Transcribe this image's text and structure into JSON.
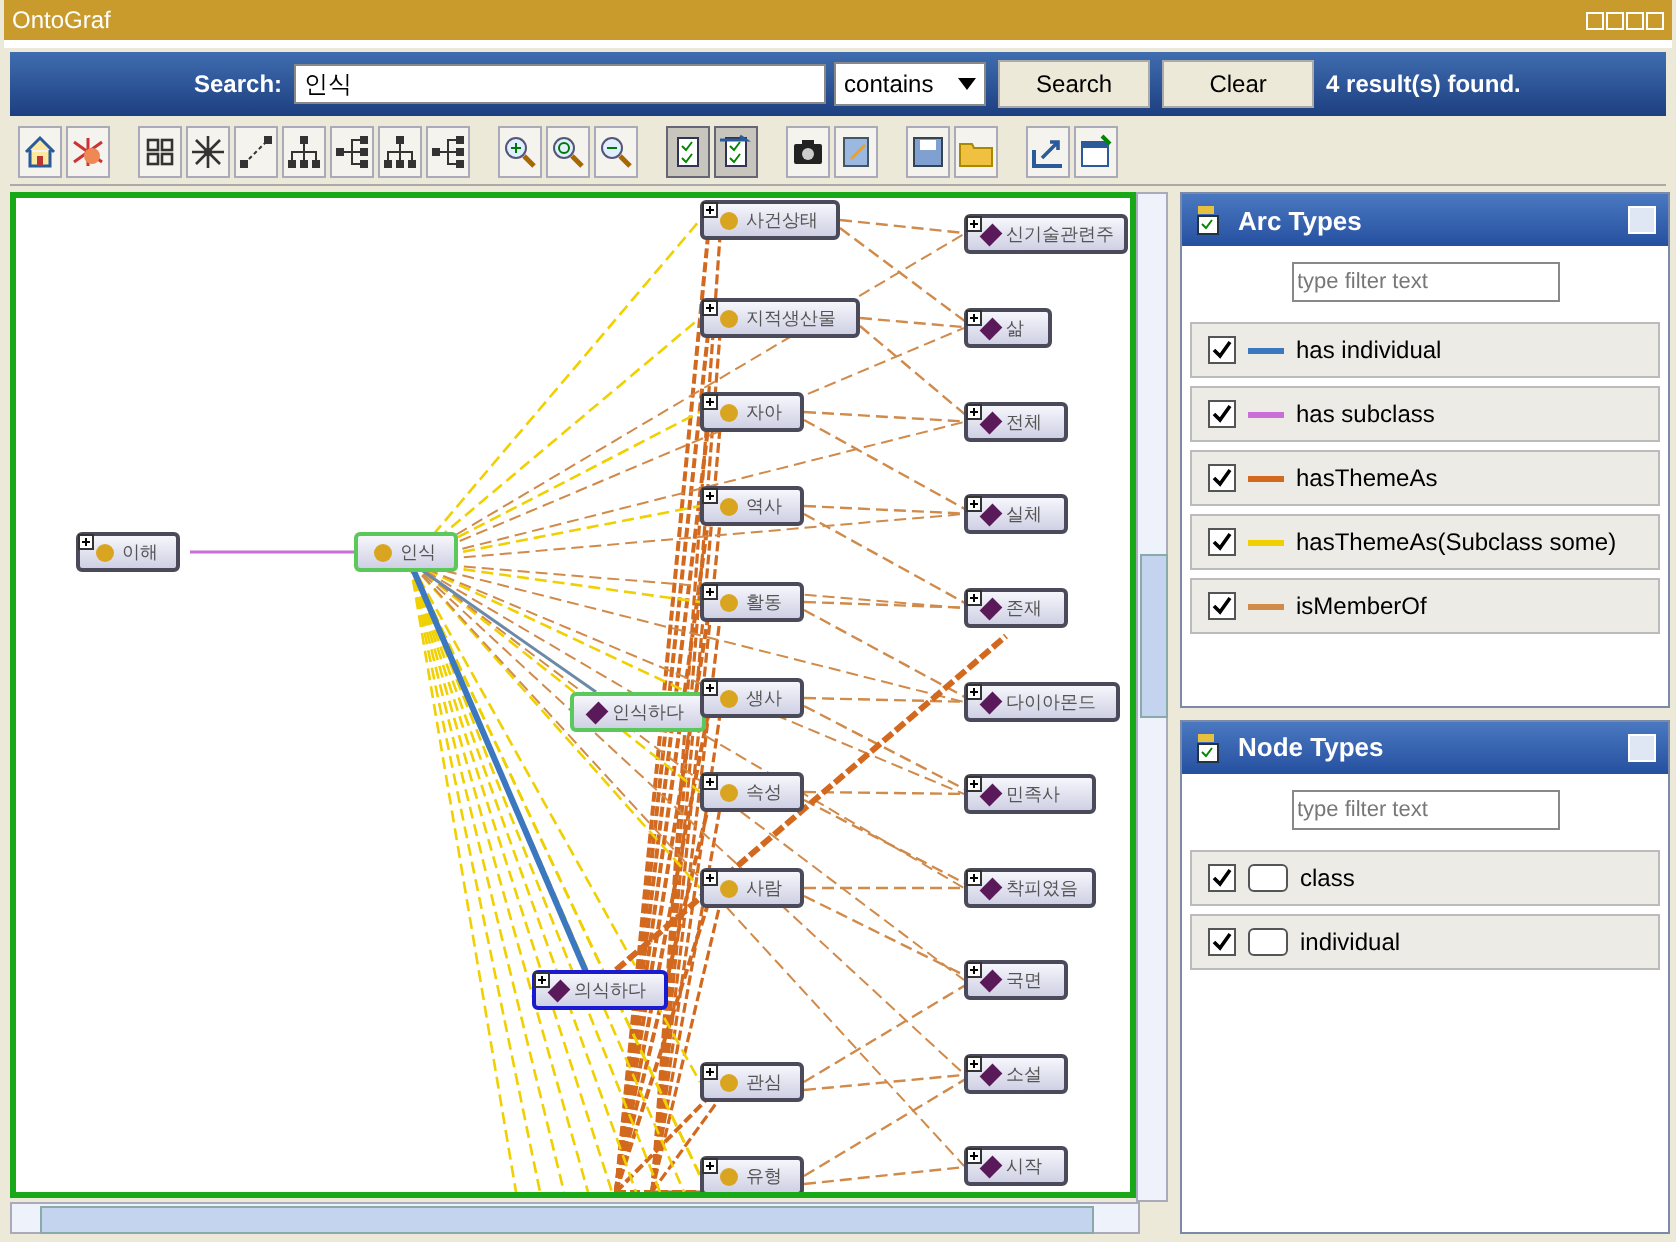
{
  "window": {
    "title": "OntoGraf"
  },
  "search": {
    "label": "Search:",
    "value": "인식",
    "mode": "contains",
    "buttons": [
      "Search",
      "Clear"
    ],
    "result": "4 result(s) found."
  },
  "toolbar": [
    {
      "kind": "home",
      "on": false
    },
    {
      "kind": "network",
      "on": false
    },
    {
      "kind": "grid",
      "on": false
    },
    {
      "kind": "radial",
      "on": false
    },
    {
      "kind": "spring",
      "on": false
    },
    {
      "kind": "tree-down",
      "on": false
    },
    {
      "kind": "tree-right",
      "on": false
    },
    {
      "kind": "tree-down",
      "on": false
    },
    {
      "kind": "tree-right",
      "on": false
    },
    {
      "kind": "zoom-in",
      "on": false
    },
    {
      "kind": "zoom-fit",
      "on": false
    },
    {
      "kind": "zoom-out",
      "on": false
    },
    {
      "kind": "checklist",
      "on": true
    },
    {
      "kind": "checklist-arrow",
      "on": true
    },
    {
      "kind": "camera",
      "on": false
    },
    {
      "kind": "note",
      "on": false
    },
    {
      "kind": "save",
      "on": false
    },
    {
      "kind": "folder",
      "on": false
    },
    {
      "kind": "export",
      "on": false
    },
    {
      "kind": "window",
      "on": false
    }
  ],
  "graph": {
    "nodes": [
      {
        "label": "이해",
        "kind": "class",
        "expandable": true,
        "matched": false,
        "selected": false
      },
      {
        "label": "인식",
        "kind": "class",
        "expandable": false,
        "matched": true,
        "selected": false
      },
      {
        "label": "인식하다",
        "kind": "individual",
        "expandable": false,
        "matched": true,
        "selected": false
      },
      {
        "label": "의식하다",
        "kind": "individual",
        "expandable": true,
        "matched": false,
        "selected": true
      }
    ],
    "column_1": [
      {
        "label": "사건상태",
        "kind": "class",
        "expandable": true
      },
      {
        "label": "지적생산물",
        "kind": "class",
        "expandable": true
      },
      {
        "label": "자아",
        "kind": "class",
        "expandable": true
      },
      {
        "label": "역사",
        "kind": "class",
        "expandable": true
      },
      {
        "label": "활동",
        "kind": "class",
        "expandable": true
      },
      {
        "label": "생사",
        "kind": "class",
        "expandable": true
      },
      {
        "label": "속성",
        "kind": "class",
        "expandable": true
      },
      {
        "label": "사람",
        "kind": "class",
        "expandable": true
      },
      {
        "label": "관심",
        "kind": "class",
        "expandable": true
      },
      {
        "label": "유형",
        "kind": "class",
        "expandable": true
      }
    ],
    "column_2": [
      {
        "label": "신기술관련주",
        "kind": "individual",
        "expandable": true
      },
      {
        "label": "삶",
        "kind": "individual",
        "expandable": true
      },
      {
        "label": "전체",
        "kind": "individual",
        "expandable": true
      },
      {
        "label": "실체",
        "kind": "individual",
        "expandable": true
      },
      {
        "label": "존재",
        "kind": "individual",
        "expandable": true
      },
      {
        "label": "다이아몬드",
        "kind": "individual",
        "expandable": true
      },
      {
        "label": "민족사",
        "kind": "individual",
        "expandable": true
      },
      {
        "label": "착피였음",
        "kind": "individual",
        "expandable": true
      },
      {
        "label": "국면",
        "kind": "individual",
        "expandable": true
      },
      {
        "label": "소설",
        "kind": "individual",
        "expandable": true
      },
      {
        "label": "시작",
        "kind": "individual",
        "expandable": true
      }
    ]
  },
  "arc_types": {
    "title": "Arc Types",
    "placeholder": "type filter text",
    "items": [
      {
        "label": "has individual",
        "checked": true,
        "color": "#3b78c0"
      },
      {
        "label": "has subclass",
        "checked": true,
        "color": "#c86fd8"
      },
      {
        "label": "hasThemeAs",
        "checked": true,
        "color": "#d2691e"
      },
      {
        "label": "hasThemeAs(Subclass some)",
        "checked": true,
        "color": "#f0d000"
      },
      {
        "label": "isMemberOf",
        "checked": true,
        "color": "#d08a4a"
      }
    ]
  },
  "node_types": {
    "title": "Node Types",
    "placeholder": "type filter text",
    "items": [
      {
        "label": "class",
        "checked": true
      },
      {
        "label": "individual",
        "checked": true
      }
    ]
  }
}
